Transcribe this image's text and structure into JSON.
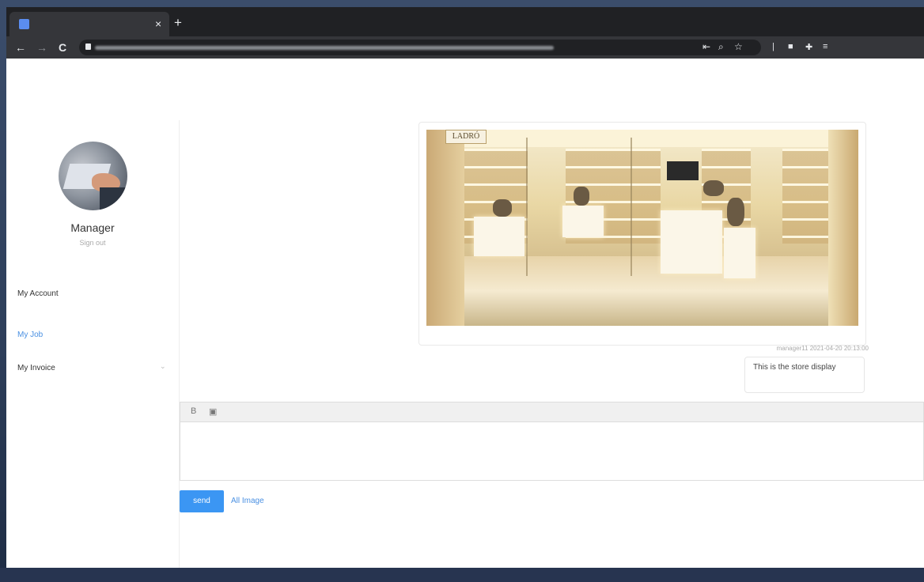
{
  "browser": {
    "new_tab_label": "+",
    "tab_close_label": "×",
    "back_label": "←",
    "forward_label": "→",
    "reload_label": "C"
  },
  "user": {
    "name": "Manager",
    "signout_label": "Sign out"
  },
  "sidebar": {
    "items": [
      {
        "label": "My Account",
        "active": false
      },
      {
        "label": "My Job",
        "active": true
      },
      {
        "label": "My Invoice",
        "active": false
      }
    ]
  },
  "store_sign": "LADRÓ",
  "message": {
    "meta": "manager11 2021-04-20 20:13:00",
    "text": "This is the store display"
  },
  "editor": {
    "bold_label": "B",
    "image_label": "▣"
  },
  "actions": {
    "send_label": "send",
    "attach_label": "All Image"
  },
  "colors": {
    "accent": "#3b96f3",
    "link": "#4a90e2"
  }
}
